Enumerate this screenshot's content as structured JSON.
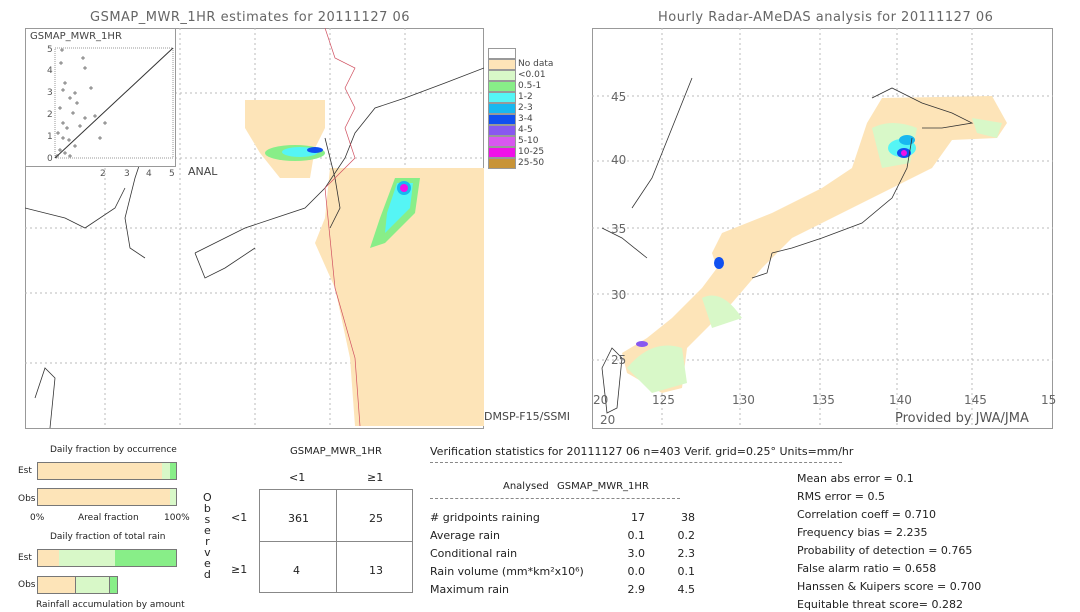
{
  "left_map": {
    "title": "GSMAP_MWR_1HR estimates for 20111127 06",
    "scatter_ylabel": "GSMAP_MWR_1HR",
    "scatter_xlabel": "ANAL",
    "scatter_ticks": [
      "0",
      "1",
      "2",
      "3",
      "4",
      "5"
    ],
    "satellite": "DMSP-F15/SSMI"
  },
  "right_map": {
    "title": "Hourly Radar-AMeDAS analysis for 20111127 06",
    "lat_labels": [
      "45",
      "40",
      "35",
      "30",
      "25",
      "20"
    ],
    "lon_labels": [
      "20",
      "125",
      "130",
      "135",
      "140",
      "145",
      "15"
    ],
    "credit": "Provided by JWA/JMA"
  },
  "legend": {
    "items": [
      {
        "label": "",
        "color": "#ffffff"
      },
      {
        "label": "No data",
        "color": "#fde4b8"
      },
      {
        "label": "<0.01",
        "color": "#d8f8c8"
      },
      {
        "label": "0.5-1",
        "color": "#88ee88"
      },
      {
        "label": "1-2",
        "color": "#55f5f5"
      },
      {
        "label": "2-3",
        "color": "#18b8f0"
      },
      {
        "label": "3-4",
        "color": "#1050f0"
      },
      {
        "label": "4-5",
        "color": "#8858f0"
      },
      {
        "label": "5-10",
        "color": "#d858f0"
      },
      {
        "label": "10-25",
        "color": "#f010e8"
      },
      {
        "label": "25-50",
        "color": "#c89438"
      }
    ]
  },
  "fraction_charts": {
    "occurrence_title": "Daily fraction by occurrence",
    "est_label": "Est",
    "obs_label": "Obs",
    "axis_left": "0%",
    "axis_mid": "Areal fraction",
    "axis_right": "100%",
    "occurrence_est": [
      0.9,
      0.06,
      0.04
    ],
    "occurrence_obs": [
      0.96,
      0.04,
      0.0
    ],
    "total_title": "Daily fraction of total rain",
    "total_est": [
      0.15,
      0.41,
      0.44
    ],
    "total_obs": [
      0.28,
      0.24,
      0.06
    ],
    "accum_title": "Rainfall accumulation by amount",
    "colors": [
      "#fde4b8",
      "#d8f8c8",
      "#88ee88"
    ]
  },
  "contingency": {
    "title": "GSMAP_MWR_1HR",
    "col_labels": [
      "<1",
      "≥1"
    ],
    "row_labels": [
      "<1",
      "≥1"
    ],
    "observed_letters": [
      "O",
      "b",
      "s",
      "e",
      "r",
      "v",
      "e",
      "d"
    ],
    "cells": [
      [
        "361",
        "25"
      ],
      [
        "4",
        "13"
      ]
    ]
  },
  "stats": {
    "header": "Verification statistics for 20111127 06   n=403   Verif. grid=0.25°   Units=mm/hr",
    "col_analysed": "Analysed",
    "col_est": "GSMAP_MWR_1HR",
    "rows": [
      {
        "label": "# gridpoints raining",
        "a": "17",
        "b": "38"
      },
      {
        "label": "Average rain",
        "a": "0.1",
        "b": "0.2"
      },
      {
        "label": "Conditional rain",
        "a": "3.0",
        "b": "2.3"
      },
      {
        "label": "Rain volume (mm*km²x10⁶)",
        "a": "0.0",
        "b": "0.1"
      },
      {
        "label": "Maximum rain",
        "a": "2.9",
        "b": "4.5"
      }
    ],
    "scores": [
      "Mean abs error = 0.1",
      "RMS error = 0.5",
      "Correlation coeff = 0.710",
      "Frequency bias = 2.235",
      "Probability of detection = 0.765",
      "False alarm ratio = 0.658",
      "Hanssen & Kuipers score = 0.700",
      "Equitable threat score= 0.282"
    ]
  }
}
